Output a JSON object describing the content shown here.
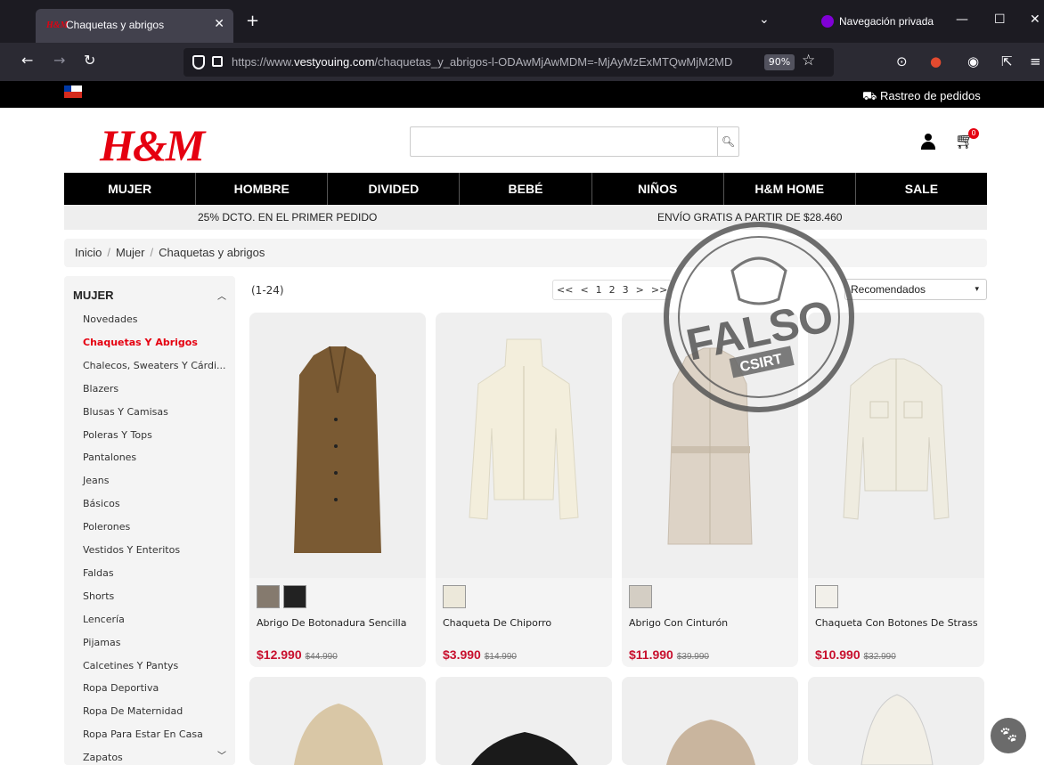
{
  "browser": {
    "tab_title": "Chaquetas y abrigos",
    "tab_favicon": "H&M",
    "private_label": "Navegación privada",
    "url_prefix": "https://www.",
    "url_host": "vestyouing.com",
    "url_path": "/chaquetas_y_abrigos-l-ODAwMjAwMDM=-MjAyMzExMTQwMjM2MD",
    "zoom": "90%"
  },
  "site": {
    "tracking_label": "Rastreo de pedidos",
    "logo": "H&M",
    "cart_count": "0",
    "menu": [
      "MUJER",
      "HOMBRE",
      "DIVIDED",
      "BEBÉ",
      "NIÑOS",
      "H&M HOME",
      "SALE"
    ],
    "promo_left": "25% DCTO. EN EL PRIMER PEDIDO",
    "promo_right": "ENVÍO GRATIS A PARTIR DE $28.460",
    "breadcrumb": [
      "Inicio",
      "Mujer",
      "Chaquetas y abrigos"
    ]
  },
  "sidebar": {
    "heading": "MUJER",
    "items": [
      {
        "label": "Novedades",
        "active": false
      },
      {
        "label": "Chaquetas Y Abrigos",
        "active": true
      },
      {
        "label": "Chalecos, Sweaters Y Cárdi...",
        "active": false
      },
      {
        "label": "Blazers",
        "active": false
      },
      {
        "label": "Blusas Y Camisas",
        "active": false
      },
      {
        "label": "Poleras Y Tops",
        "active": false
      },
      {
        "label": "Pantalones",
        "active": false
      },
      {
        "label": "Jeans",
        "active": false
      },
      {
        "label": "Básicos",
        "active": false
      },
      {
        "label": "Polerones",
        "active": false
      },
      {
        "label": "Vestidos Y Enteritos",
        "active": false
      },
      {
        "label": "Faldas",
        "active": false
      },
      {
        "label": "Shorts",
        "active": false
      },
      {
        "label": "Lencería",
        "active": false
      },
      {
        "label": "Pijamas",
        "active": false
      },
      {
        "label": "Calcetines Y Pantys",
        "active": false
      },
      {
        "label": "Ropa Deportiva",
        "active": false
      },
      {
        "label": "Ropa De Maternidad",
        "active": false
      },
      {
        "label": "Ropa Para Estar En Casa",
        "active": false
      },
      {
        "label": "Zapatos",
        "active": false
      }
    ]
  },
  "listing": {
    "count": "(1-24)",
    "pager": [
      "<<",
      "<",
      "1",
      "2",
      "3",
      ">",
      ">>"
    ],
    "sort": "Recomendados"
  },
  "products": [
    {
      "name": "Abrigo De Botonadura Sencilla",
      "price": "$12.990",
      "old_price": "$44.990",
      "swatches": [
        "#857a6e",
        "#222222"
      ],
      "garment": "#7a5a33"
    },
    {
      "name": "Chaqueta De Chiporro",
      "price": "$3.990",
      "old_price": "$14.990",
      "swatches": [
        "#ece8da"
      ],
      "garment": "#f3eedc"
    },
    {
      "name": "Abrigo Con Cinturón",
      "price": "$11.990",
      "old_price": "$39.990",
      "swatches": [
        "#d4cec4"
      ],
      "garment": "#ddd3c6"
    },
    {
      "name": "Chaqueta Con Botones De Strass",
      "price": "$10.990",
      "old_price": "$32.990",
      "swatches": [
        "#f2f0ea"
      ],
      "garment": "#efece0"
    }
  ],
  "stamp": {
    "word": "FALSO",
    "org": "CSIRT"
  }
}
